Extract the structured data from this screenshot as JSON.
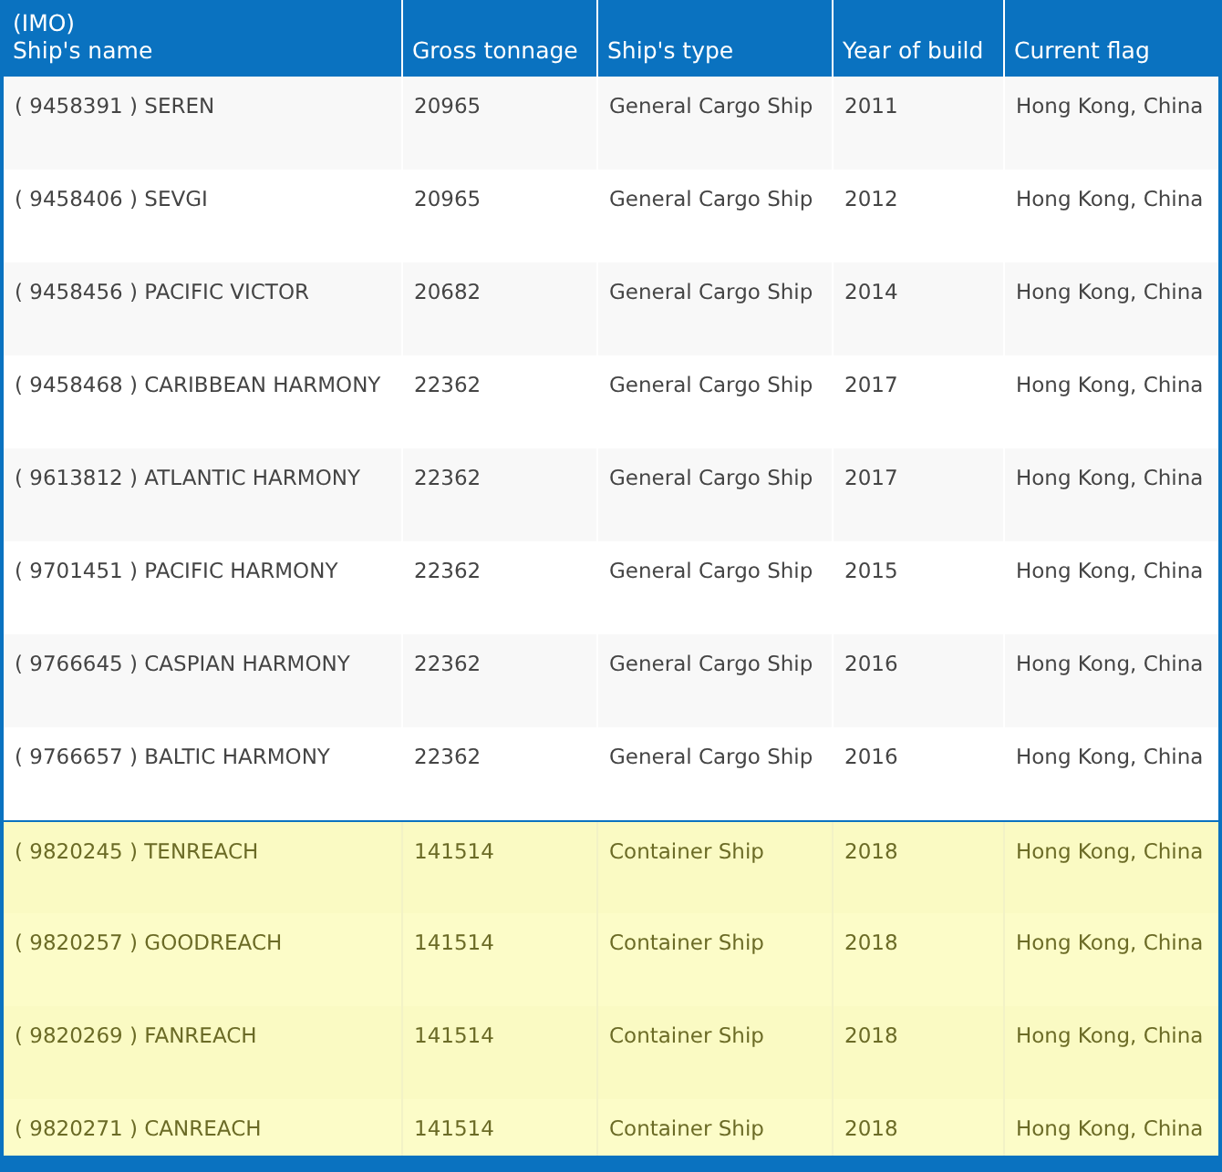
{
  "table": {
    "columns": [
      {
        "label_lines": [
          "(IMO)",
          "Ship's name"
        ]
      },
      {
        "label_lines": [
          "Gross tonnage"
        ]
      },
      {
        "label_lines": [
          "Ship's type"
        ]
      },
      {
        "label_lines": [
          "Year of build"
        ]
      },
      {
        "label_lines": [
          "Current flag"
        ]
      }
    ],
    "rows": [
      {
        "name": "( 9458391 ) SEREN",
        "tonnage": "20965",
        "type": "General Cargo Ship",
        "year": "2011",
        "flag": "Hong Kong, China",
        "highlighted": false
      },
      {
        "name": "( 9458406 ) SEVGI",
        "tonnage": "20965",
        "type": "General Cargo Ship",
        "year": "2012",
        "flag": "Hong Kong, China",
        "highlighted": false
      },
      {
        "name": "( 9458456 ) PACIFIC VICTOR",
        "tonnage": "20682",
        "type": "General Cargo Ship",
        "year": "2014",
        "flag": "Hong Kong, China",
        "highlighted": false
      },
      {
        "name": "( 9458468 ) CARIBBEAN HARMONY",
        "tonnage": "22362",
        "type": "General Cargo Ship",
        "year": "2017",
        "flag": "Hong Kong, China",
        "highlighted": false
      },
      {
        "name": "( 9613812 ) ATLANTIC HARMONY",
        "tonnage": "22362",
        "type": "General Cargo Ship",
        "year": "2017",
        "flag": "Hong Kong, China",
        "highlighted": false
      },
      {
        "name": "( 9701451 ) PACIFIC HARMONY",
        "tonnage": "22362",
        "type": "General Cargo Ship",
        "year": "2015",
        "flag": "Hong Kong, China",
        "highlighted": false
      },
      {
        "name": "( 9766645 ) CASPIAN HARMONY",
        "tonnage": "22362",
        "type": "General Cargo Ship",
        "year": "2016",
        "flag": "Hong Kong, China",
        "highlighted": false
      },
      {
        "name": "( 9766657 ) BALTIC HARMONY",
        "tonnage": "22362",
        "type": "General Cargo Ship",
        "year": "2016",
        "flag": "Hong Kong, China",
        "highlighted": false
      },
      {
        "name": "( 9820245 ) TENREACH",
        "tonnage": "141514",
        "type": "Container Ship",
        "year": "2018",
        "flag": "Hong Kong, China",
        "highlighted": true
      },
      {
        "name": "( 9820257 ) GOODREACH",
        "tonnage": "141514",
        "type": "Container Ship",
        "year": "2018",
        "flag": "Hong Kong, China",
        "highlighted": true
      },
      {
        "name": "( 9820269 ) FANREACH",
        "tonnage": "141514",
        "type": "Container Ship",
        "year": "2018",
        "flag": "Hong Kong, China",
        "highlighted": true
      },
      {
        "name": "( 9820271 ) CANREACH",
        "tonnage": "141514",
        "type": "Container Ship",
        "year": "2018",
        "flag": "Hong Kong, China",
        "highlighted": true
      }
    ]
  }
}
